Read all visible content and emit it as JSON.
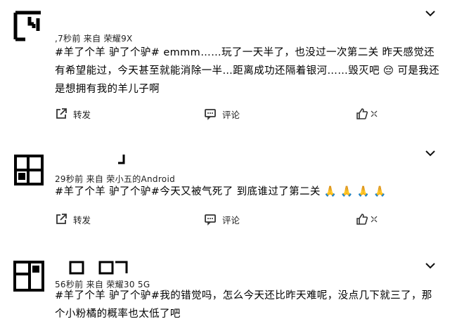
{
  "posts": [
    {
      "meta": ",7秒前 来自 荣耀9X",
      "content": "#羊了个羊 驴了个驴# emmm……玩了一天半了，也没过一次第二关 昨天感觉还有希望能过，今天甚至就能消除一半…距离成功还隔着银河……毁灭吧 😔 可是我还是想拥有我的羊儿子啊",
      "actions": {
        "share": "转发",
        "comment": "评论",
        "like": ""
      }
    },
    {
      "meta": "29秒前 来自 荣小五的Android",
      "content": "#羊了个羊 驴了个驴#今天又被气死了 到底谁过了第二关 🙏 🙏 🙏 🙏",
      "actions": {
        "share": "转发",
        "comment": "评论",
        "like": ""
      }
    },
    {
      "meta": "56秒前 来自 荣耀30 5G",
      "content": "#羊了个羊 驴了个驴#我的错觉吗，怎么今天还比昨天难呢，没点几下就三了，那个小粉橘的概率也太低了吧",
      "actions": null
    }
  ],
  "colors": {
    "text": "#000000",
    "meta": "#222222",
    "icon": "#333333"
  }
}
